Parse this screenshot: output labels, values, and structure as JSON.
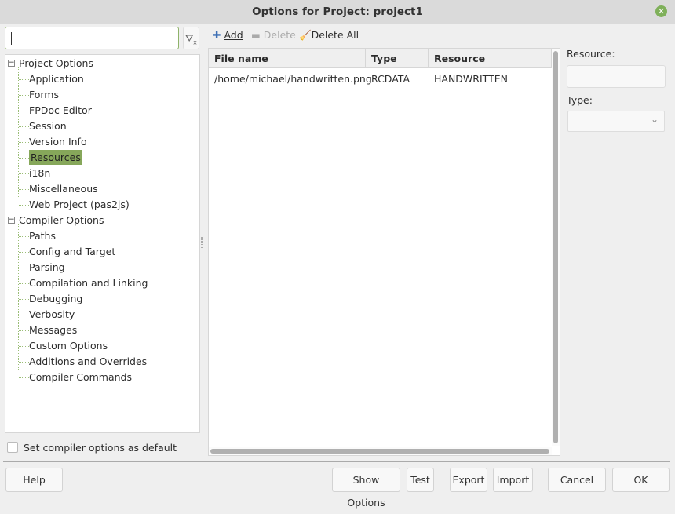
{
  "window": {
    "title": "Options for Project: project1",
    "close_icon": "close-icon",
    "accent": "#86a75a"
  },
  "search": {
    "value": "",
    "filter_icon": "filter-clear-icon"
  },
  "tree": [
    {
      "label": "Project Options",
      "level": 0,
      "expanded": true
    },
    {
      "label": "Application",
      "level": 1
    },
    {
      "label": "Forms",
      "level": 1
    },
    {
      "label": "FPDoc Editor",
      "level": 1
    },
    {
      "label": "Session",
      "level": 1
    },
    {
      "label": "Version Info",
      "level": 1
    },
    {
      "label": "Resources",
      "level": 1,
      "selected": true
    },
    {
      "label": "i18n",
      "level": 1
    },
    {
      "label": "Miscellaneous",
      "level": 1
    },
    {
      "label": "Web Project (pas2js)",
      "level": 1
    },
    {
      "label": "Compiler Options",
      "level": 0,
      "expanded": true
    },
    {
      "label": "Paths",
      "level": 1
    },
    {
      "label": "Config and Target",
      "level": 1
    },
    {
      "label": "Parsing",
      "level": 1
    },
    {
      "label": "Compilation and Linking",
      "level": 1
    },
    {
      "label": "Debugging",
      "level": 1
    },
    {
      "label": "Verbosity",
      "level": 1
    },
    {
      "label": "Messages",
      "level": 1
    },
    {
      "label": "Custom Options",
      "level": 1
    },
    {
      "label": "Additions and Overrides",
      "level": 1
    },
    {
      "label": "Compiler Commands",
      "level": 1
    }
  ],
  "checkbox": {
    "label": "Set compiler options as default",
    "checked": false
  },
  "toolbar": {
    "add": "Add",
    "delete": "Delete",
    "delete_all": "Delete All"
  },
  "table": {
    "headers": [
      "File name",
      "Type",
      "Resource"
    ],
    "rows": [
      [
        "/home/michael/handwritten.png",
        "RCDATA",
        "HANDWRITTEN"
      ]
    ]
  },
  "side": {
    "resource_label": "Resource:",
    "resource_value": "",
    "type_label": "Type:",
    "type_value": ""
  },
  "buttons": {
    "help": "Help",
    "show_options": "Show Options",
    "test": "Test",
    "export": "Export",
    "import": "Import",
    "cancel": "Cancel",
    "ok": "OK"
  }
}
